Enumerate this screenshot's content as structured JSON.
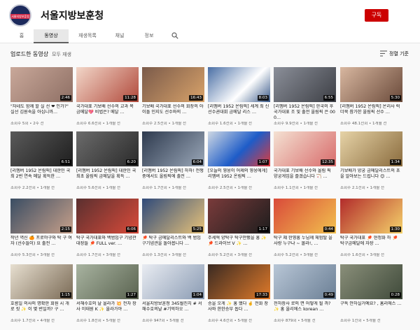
{
  "channel": {
    "name": "서울지방보훈청",
    "avatar_text": "서울지방보훈청",
    "subscribe_label": "구독"
  },
  "tabs": [
    {
      "label": "홈"
    },
    {
      "label": "동영상"
    },
    {
      "label": "재생목록"
    },
    {
      "label": "채널"
    },
    {
      "label": "정보"
    }
  ],
  "uploads": {
    "title": "업로드한 동영상",
    "play_all": "모두 재생",
    "sort_label": "정렬 기준"
  },
  "colors": {
    "subscribe": "#cc0000",
    "meta": "#606060",
    "background": "#f9f9f9"
  },
  "videos": [
    {
      "title": "\"자네도 함께 할 실 선 ❤ 인가?\" 실선 김원숙을 아십니까…",
      "meta": "조회수 5회 • 2주 전",
      "duration": "2:46"
    },
    {
      "title": "국가대표 기보배 선수의 교과 목 금메달💖 비법은? 메달 …",
      "meta": "조회수 6.6천회 • 1개월 전",
      "duration": "11:28"
    },
    {
      "title": "기보배 국가대표 선수의 회장의 아이돌 인지도 선수와의 …",
      "meta": "조회수 2.5천회 • 1개월 전",
      "duration": "16:43"
    },
    {
      "title": "[리멤버 1952 온림픽] 세계 최 신선수권대회 금메달 리스 …",
      "meta": "조회수 1.6천회 • 1개월 전",
      "duration": "8:03"
    },
    {
      "title": "[리멤버 1952 온림픽] 한국의 후 국가대표 조 및 출전 올림픽 은 000…",
      "meta": "조회수 9.9천회 • 1개월 전",
      "duration": "6:55"
    },
    {
      "title": "[리멤버 1952 온림픽] 온리사 럭더북 참가한 올림픽 선수 …",
      "meta": "조회수 48.1천회 • 1개월 전",
      "duration": "5:30"
    },
    {
      "title": "[리멤버 1952 온림픽] 대한민 국 최 2번 연속 메달 획득한 …",
      "meta": "조회수 2.2천회 • 1개월 전",
      "duration": "6:51"
    },
    {
      "title": "[리멤버 1952 온림픽] 대한민 국 최초 올림픽 금메달을 획득 …",
      "meta": "조회수 5.6천회 • 1개월 전",
      "duration": "6:20"
    },
    {
      "title": "[리멤버 1952 온림픽] 하하! 전쟁 중에서도 올림픽에 출전 …",
      "meta": "조회수 1.7천회 • 1개월 전",
      "duration": "6:04"
    },
    {
      "title": "[오늘의 영웅이 어제의 영웅에게] 리멤버 1952 온림픽 …",
      "meta": "조회수 2.5천회 • 1개월 전",
      "duration": "1:07"
    },
    {
      "title": "국가대표 기보배 선수와 올림 픽 양궁게임을 즐겼습니다 🏹 …",
      "meta": "조회수 1.1천회 • 1개월 전",
      "duration": "12:35"
    },
    {
      "title": "기보배가 양궁 금메달리스트의 초을 알아보는 드립니다 😊 …",
      "meta": "조회수 2.1천회 • 1개월 전",
      "duration": "1:34"
    },
    {
      "title": "작년 역신 🍊 프로야구와 탁 구 여자 (선수들이) 요 출전 …",
      "meta": "조회수 5.3천회 • 3개월 전",
      "duration": "2:15"
    },
    {
      "title": "탁구 국가대표와 백범입구 기념관 대장들 🏓 FULL ver. …",
      "meta": "조회수 1.7천회 • 3개월 전",
      "duration": "6:06"
    },
    {
      "title": "🏓 탁구 금메달리스트와 백 범입구기념관을 돌아봅니다 …",
      "meta": "조회수 1.3천회 • 3개월 전",
      "duration": "5:25"
    },
    {
      "title": "주세혁 양탁구 탁구만됐을 흥 ✨ 🏓 드라이브 V ✨ …",
      "meta": "조회수 5.2천회 • 3개월 전",
      "duration": "1:17"
    },
    {
      "title": "탁구 쟤 한영흥 누님께 체험탈 을 사랑 누구냐 ~ 몰라!, …",
      "meta": "조회수 5.2천회 • 3개월 전",
      "duration": "0:44"
    },
    {
      "title": "탁구 국가대표 🏓 현정화 하 🏓 탁구금메달에 자장 …",
      "meta": "조회수 1.6천회 • 3개월 전",
      "duration": "1:30"
    },
    {
      "title": "호룡일 의사의 명확한 회원 시 개로 짓 ✨ 이 몇 번일까? 구 …",
      "meta": "조회수 1.7천회 • 4개월 전",
      "duration": "1:15"
    },
    {
      "title": "서해수호의 날 올라가 💥 전차 장사 이태원 K ✨ 올라가야 …",
      "meta": "조회수 1.8천회 • 5개월 전",
      "duration": "1:27"
    },
    {
      "title": "서울지방보훈청 345월진치 # 서해수호의날 #기억하오 …",
      "meta": "조회수 947회 • 5개월 전",
      "duration": "1:04"
    },
    {
      "title": "승을 오게 ✨ 홍 했다 🤞 전화 장사와 한한승부 돕다 …",
      "meta": "조회수 4.6천회 • 5개월 전",
      "duration": "17:33"
    },
    {
      "title": "천하장사 로의 면 어떻게 될 까? ✨ 홍 올리에스 korean …",
      "meta": "조회수 879회 • 5개월 전",
      "duration": "0:49"
    },
    {
      "title": "구독 안하실거예요? , 홈리에스 …",
      "meta": "조회수 1천회 • 5개월 전",
      "duration": "0:28"
    }
  ]
}
